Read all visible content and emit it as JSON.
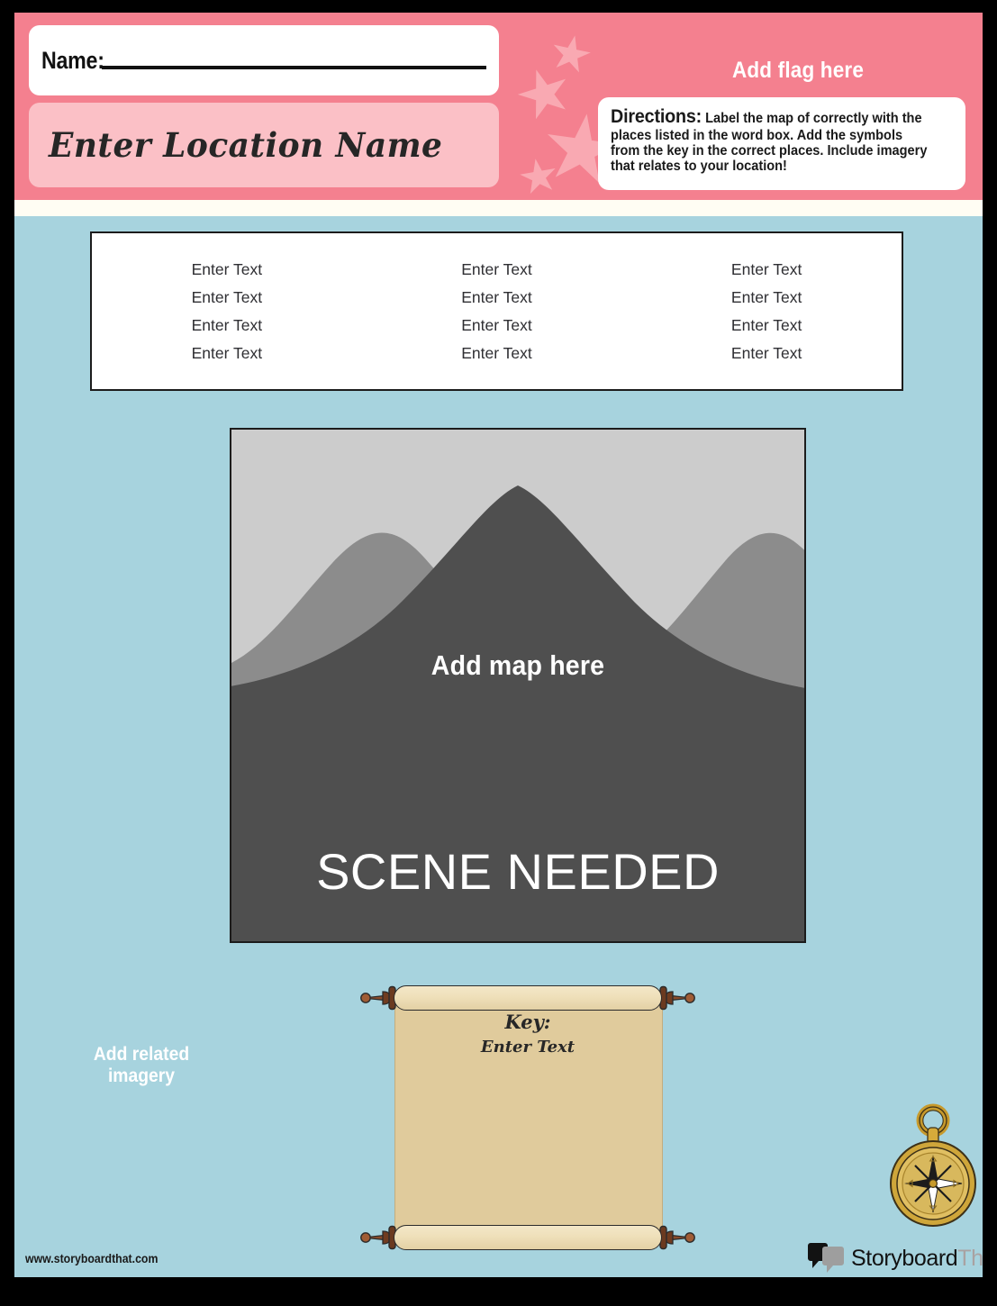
{
  "theme": {
    "header_pink": "#F4808F",
    "star_pink": "#F9A9B2",
    "card_pink": "#FBC0C6",
    "body_blue": "#A7D3DE",
    "parchment": "#E0CB9C",
    "scene_dark": "#4F4F4F"
  },
  "header": {
    "name_label": "Name:",
    "location_placeholder": "Enter Location Name",
    "add_flag_label": "Add flag here",
    "directions_label": "Directions:",
    "directions_text": "Label the map of  correctly with the places listed in the word box.  Add the symbols from the key in the correct places. Include imagery that relates to your location!"
  },
  "word_box": {
    "columns": 3,
    "rows": 4,
    "cells": [
      "Enter Text",
      "Enter Text",
      "Enter Text",
      "Enter Text",
      "Enter Text",
      "Enter Text",
      "Enter Text",
      "Enter Text",
      "Enter Text",
      "Enter Text",
      "Enter Text",
      "Enter Text"
    ]
  },
  "map_scene": {
    "caption_top": "Add map here",
    "caption_main": "SCENE NEEDED"
  },
  "key_scroll": {
    "title": "Key:",
    "value": "Enter Text"
  },
  "related_imagery": {
    "line1": "Add related",
    "line2": "imagery"
  },
  "footer": {
    "url": "www.storyboardthat.com",
    "logo_dark": "Storyboard",
    "logo_grey": "That"
  },
  "icons": {
    "compass": "compass-icon",
    "scroll": "scroll-icon",
    "star": "star-icon",
    "speech_bubble": "speech-bubble-icon",
    "mountain": "mountain-icon"
  }
}
